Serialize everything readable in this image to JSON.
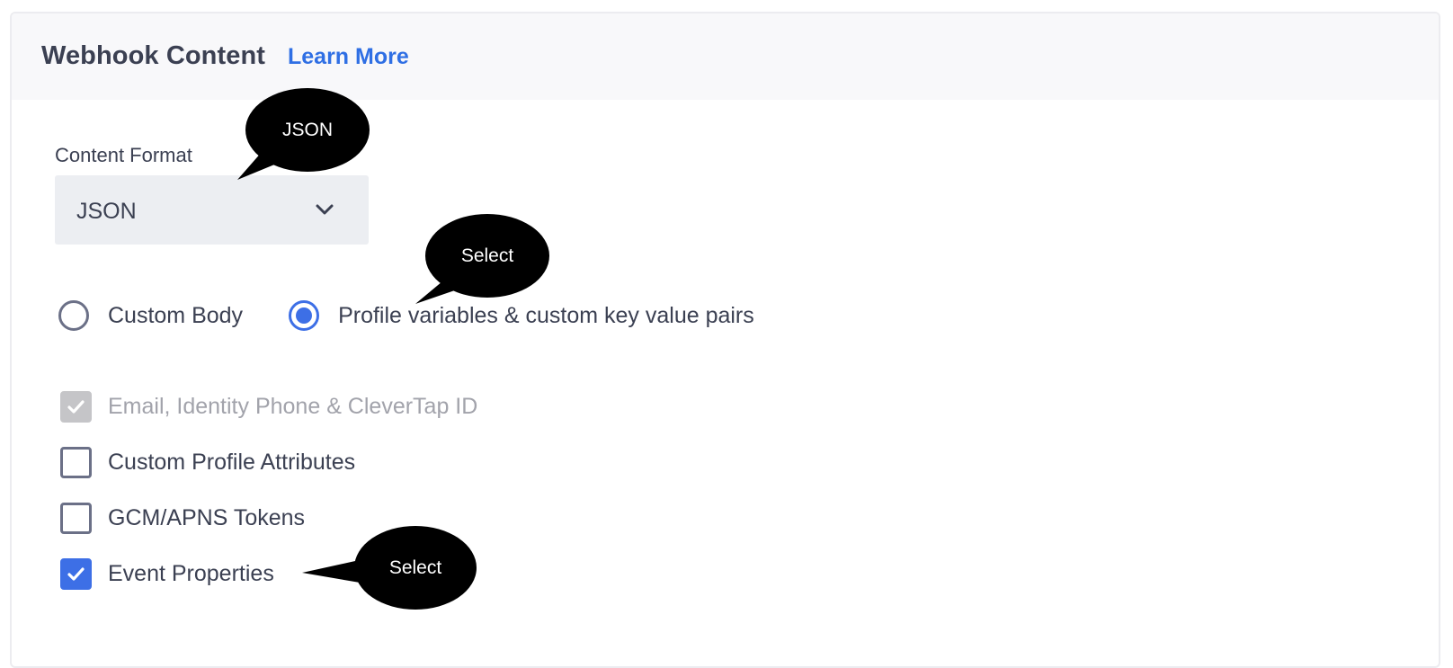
{
  "header": {
    "title": "Webhook Content",
    "learn_more": "Learn More"
  },
  "content_format": {
    "label": "Content Format",
    "selected": "JSON"
  },
  "body_type": {
    "options": [
      {
        "label": "Custom Body",
        "checked": false
      },
      {
        "label": "Profile variables & custom key value pairs",
        "checked": true
      }
    ]
  },
  "attributes": [
    {
      "label": "Email, Identity Phone & CleverTap ID",
      "checked": true,
      "disabled": true
    },
    {
      "label": "Custom Profile Attributes",
      "checked": false,
      "disabled": false
    },
    {
      "label": "GCM/APNS Tokens",
      "checked": false,
      "disabled": false
    },
    {
      "label": "Event Properties",
      "checked": true,
      "disabled": false
    }
  ],
  "annotations": {
    "format_callout": "JSON",
    "radio_callout": "Select",
    "checkbox_callout": "Select"
  },
  "colors": {
    "accent": "#3d6fe6",
    "link": "#2f6fe4",
    "text": "#3b4052",
    "disabled_text": "#a2a3ab",
    "header_bg": "#f8f8fa",
    "select_bg": "#eceef2"
  }
}
